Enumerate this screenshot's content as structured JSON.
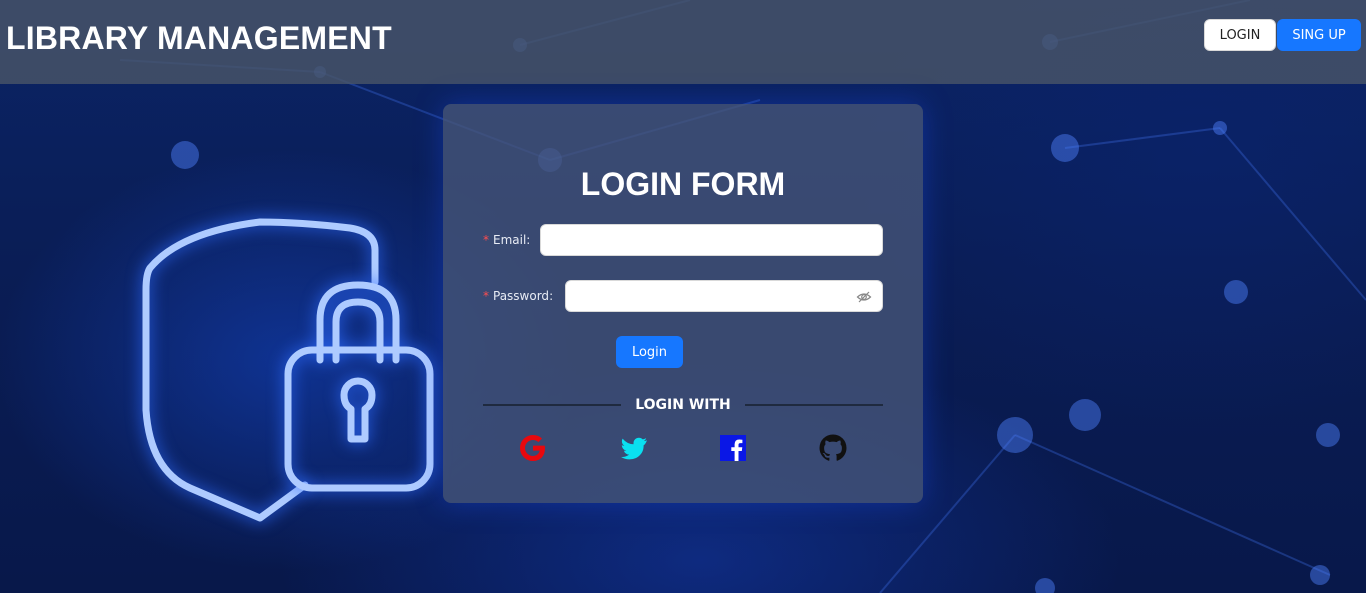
{
  "header": {
    "title": "LIBRARY MANAGEMENT",
    "login_label": "LOGIN",
    "signup_label": "SING UP"
  },
  "login_form": {
    "title": "LOGIN FORM",
    "email_label": "Email",
    "password_label": "Password",
    "required_mark": "*",
    "label_colon": ":",
    "email_value": "",
    "password_value": "",
    "submit_label": "Login",
    "divider_text": "LOGIN WITH"
  },
  "social_logins": [
    {
      "name": "Google",
      "icon": "google-icon",
      "color": "#e8080e"
    },
    {
      "name": "Twitter",
      "icon": "twitter-icon",
      "color": "#0ae0f0"
    },
    {
      "name": "Facebook",
      "icon": "facebook-icon",
      "color": "#0a17e6"
    },
    {
      "name": "GitHub",
      "icon": "github-icon",
      "color": "#111111"
    }
  ],
  "colors": {
    "primary": "#1677ff",
    "header_bg": "#485468",
    "required": "#ff4d4f"
  }
}
